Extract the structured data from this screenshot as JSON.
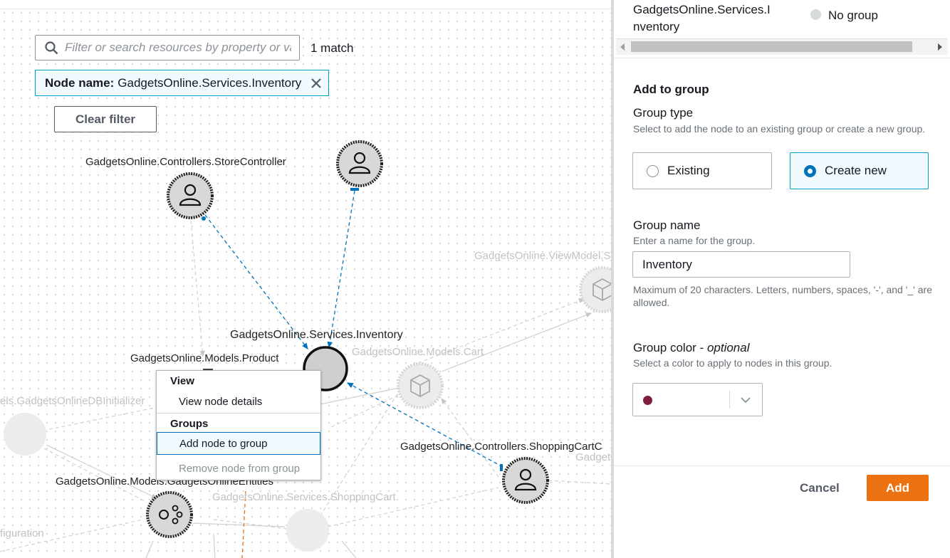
{
  "search": {
    "placeholder": "Filter or search resources by property or value",
    "match_count": "1 match",
    "token_key": "Node name:",
    "token_value": "GadgetsOnline.Services.Inventory",
    "clear_filter_label": "Clear filter"
  },
  "graph": {
    "nodes": {
      "store_controller": "GadgetsOnline.Controllers.StoreController",
      "inventory": "GadgetsOnline.Services.Inventory",
      "product": "GadgetsOnline.Models.Product",
      "cart": "GadgetsOnline.Models.Cart",
      "viewmodel": "GadgetsOnline.ViewModel.S",
      "db_initializer": "els.GadgetsOnlineDBInitializer",
      "shopping_cart_controller": "GadgetsOnline.Controllers.ShoppingCartC",
      "gadget_partial": "Gadget",
      "entities": "GadgetsOnline.Models.GadgetsOnlineEntities",
      "shopping_cart_service": "GadgetsOnline.Services.ShoppingCart",
      "configuration": "figuration"
    }
  },
  "context_menu": {
    "view_header": "View",
    "view_node_details": "View node details",
    "groups_header": "Groups",
    "add_node_to_group": "Add node to group",
    "remove_node_from_group": "Remove node from group"
  },
  "panel": {
    "table_row": {
      "node_name_line1": "GadgetsOnline.Services.I",
      "node_name_line2": "nventory",
      "group_status": "No group"
    },
    "add_to_group_title": "Add to group",
    "group_type": {
      "label": "Group type",
      "description": "Select to add the node to an existing group or create a new group.",
      "options": [
        "Existing",
        "Create new"
      ],
      "selected": "Create new"
    },
    "group_name": {
      "label": "Group name",
      "description": "Enter a name for the group.",
      "value": "Inventory",
      "constraint": "Maximum of 20 characters. Letters, numbers, spaces, '-', and '_' are allowed."
    },
    "group_color": {
      "label": "Group color - ",
      "optional": "optional",
      "description": "Select a color to apply to nodes in this group.",
      "selected_color": "#7d1e3e"
    },
    "cancel_label": "Cancel",
    "add_label": "Add"
  }
}
